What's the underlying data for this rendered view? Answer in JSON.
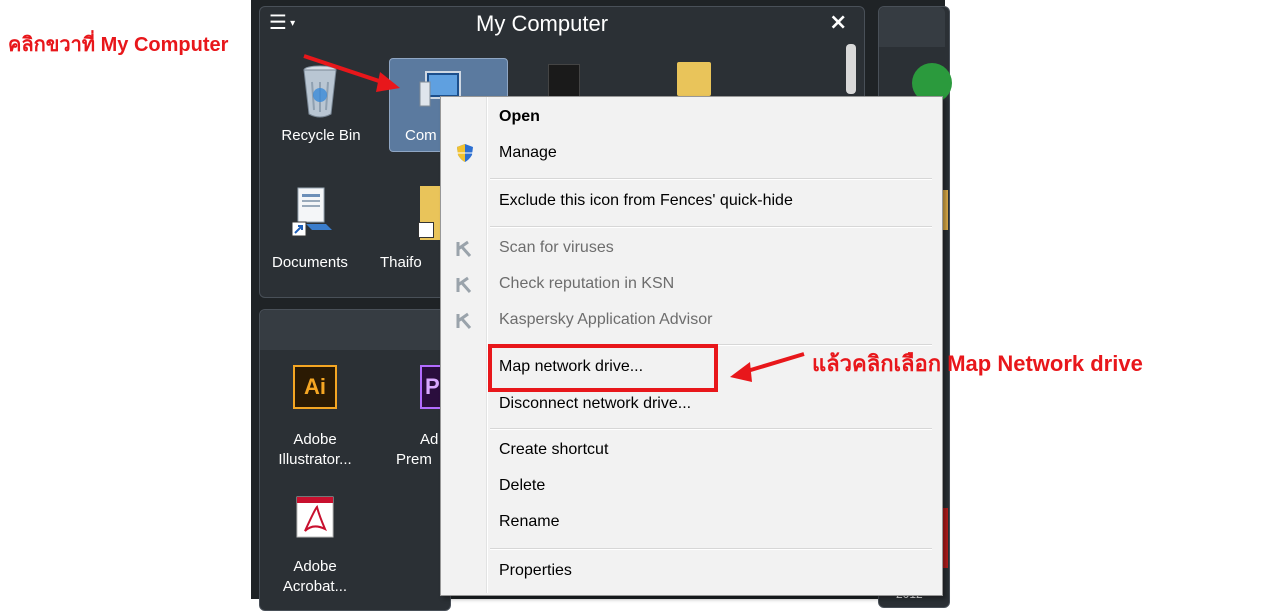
{
  "fence_top": {
    "title": "My Computer",
    "close_glyph": "×",
    "menu_glyph": "☰"
  },
  "icons_top": [
    {
      "label": "Recycle Bin",
      "icon": "recycle-bin-icon"
    },
    {
      "label": "Com",
      "icon": "computer-icon"
    },
    {
      "label": "Documents",
      "icon": "documents-shortcut-icon"
    },
    {
      "label": "Thaifo",
      "icon": "folder-shortcut-icon"
    }
  ],
  "icons_bottom": [
    {
      "label_line1": "Adobe",
      "label_line2": "Illustrator...",
      "icon": "adobe-illustrator-icon",
      "badge": "Ai"
    },
    {
      "label_line1": "Ad",
      "label_line2": "Prem",
      "icon": "adobe-premiere-icon",
      "badge": "P"
    },
    {
      "label_line1": "Adobe",
      "label_line2": "Acrobat...",
      "icon": "adobe-acrobat-icon"
    }
  ],
  "context_menu": {
    "items": [
      {
        "label": "Open",
        "bold": true,
        "disabled": false
      },
      {
        "label": "Manage",
        "bold": false,
        "disabled": false,
        "icon": "shield-icon"
      },
      {
        "label": "Exclude this icon from Fences' quick-hide",
        "bold": false,
        "disabled": false
      },
      {
        "label": "Scan for viruses",
        "bold": false,
        "disabled": true,
        "icon": "kaspersky-icon"
      },
      {
        "label": "Check reputation in KSN",
        "bold": false,
        "disabled": true,
        "icon": "kaspersky-icon"
      },
      {
        "label": "Kaspersky Application Advisor",
        "bold": false,
        "disabled": true,
        "icon": "kaspersky-icon"
      },
      {
        "label": "Map network drive...",
        "bold": false,
        "disabled": false
      },
      {
        "label": "Disconnect network drive...",
        "bold": false,
        "disabled": false
      },
      {
        "label": "Create shortcut",
        "bold": false,
        "disabled": false
      },
      {
        "label": "Delete",
        "bold": false,
        "disabled": false
      },
      {
        "label": "Rename",
        "bold": false,
        "disabled": false
      },
      {
        "label": "Properties",
        "bold": false,
        "disabled": false
      }
    ]
  },
  "annotations": {
    "top_left_prefix": "คลิกขวาที่",
    "top_left_target": "My Computer",
    "right_prefix": "แล้วคลิกเลือก",
    "right_target": "Map Network drive",
    "color": "#e8171b"
  },
  "right_fence_partial": {
    "label_fragment": "2012"
  }
}
